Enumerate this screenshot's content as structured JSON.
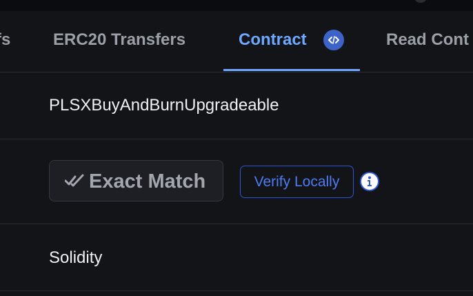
{
  "tabs": [
    {
      "label": "fs"
    },
    {
      "label": "ERC20 Transfers"
    },
    {
      "label": "Contract"
    },
    {
      "label": "Read Cont"
    }
  ],
  "contract": {
    "name": "PLSXBuyAndBurnUpgradeable",
    "verification_status": "Exact Match",
    "verify_locally_label": "Verify Locally",
    "language": "Solidity"
  },
  "icons": {
    "tab_badge": "code-icon",
    "verified": "double-check-icon",
    "info": "info-icon"
  },
  "colors": {
    "accent": "#6ea8fe",
    "badge": "#3d63c8",
    "verify": "#2f55d4",
    "background": "#121418"
  }
}
